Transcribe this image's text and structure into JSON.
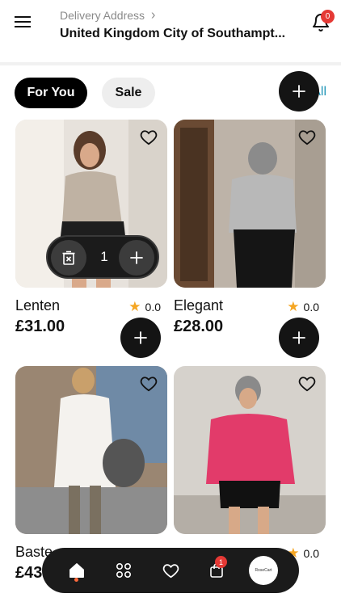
{
  "header": {
    "delivery_label": "Delivery Address",
    "delivery_address": "United Kingdom City of Southampt...",
    "notification_count": "0"
  },
  "filters": {
    "chips": [
      {
        "label": "For You",
        "selected": true
      },
      {
        "label": "Sale",
        "selected": false
      }
    ],
    "see_all": "See All"
  },
  "products": [
    {
      "name": "Lenten",
      "rating": "0.0",
      "price": "£31.00",
      "in_cart_qty": "1"
    },
    {
      "name": "Elegant",
      "rating": "0.0",
      "price": "£28.00"
    },
    {
      "name": "Baste",
      "rating": "",
      "price": "£43"
    },
    {
      "name": "",
      "rating": "0.0",
      "price": ""
    }
  ],
  "bottom_nav": {
    "items": [
      "home-icon",
      "grid-icon",
      "heart-icon",
      "cart-icon",
      "brand-logo"
    ],
    "active": "home-icon",
    "cart_badge": "1",
    "logo_text": "RoseCart"
  },
  "colors": {
    "accent_link": "#2196b8",
    "badge": "#e53935",
    "star": "#f5a623",
    "dark": "#1b1b1b"
  }
}
